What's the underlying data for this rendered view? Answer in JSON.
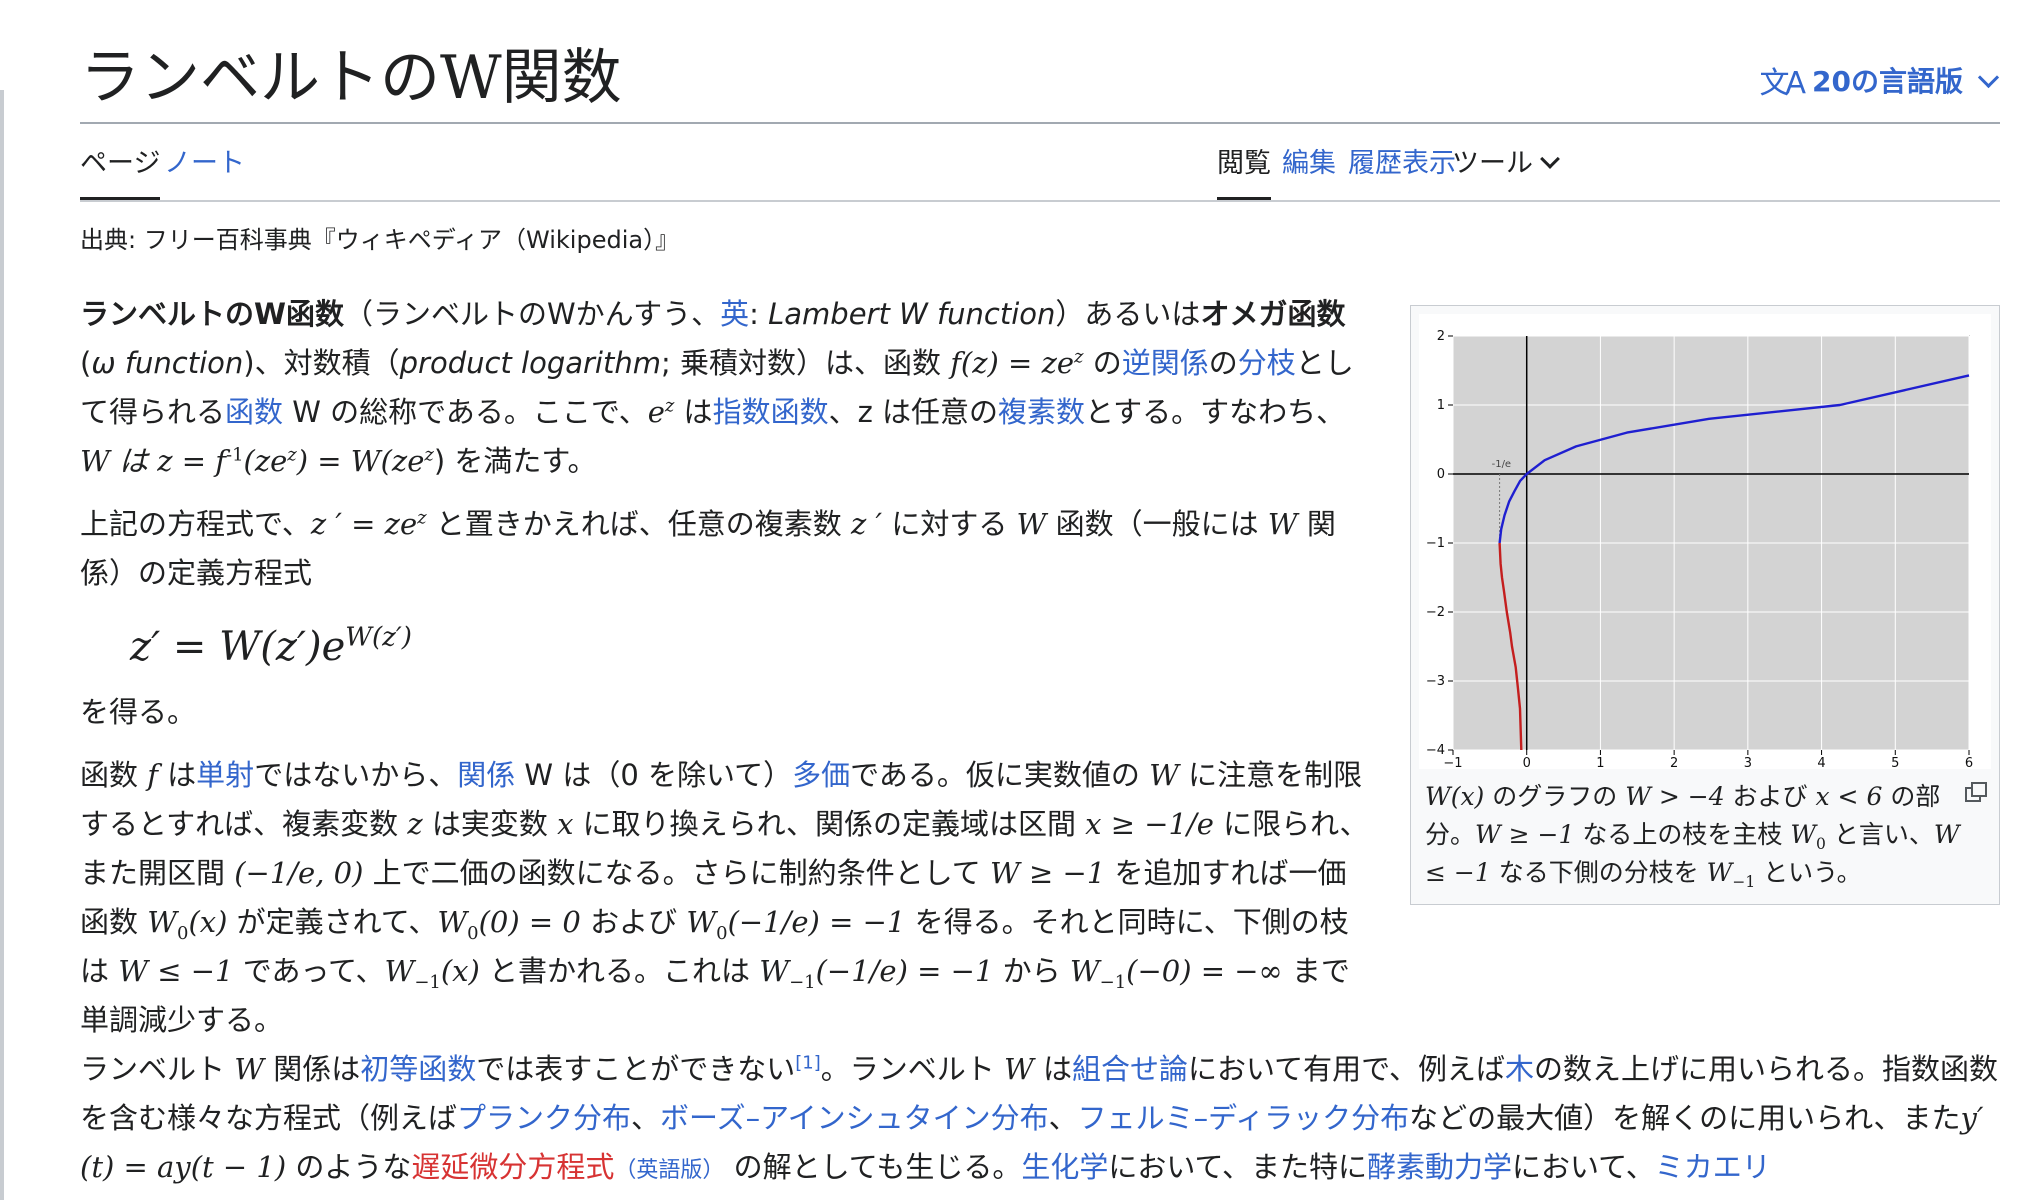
{
  "header": {
    "title": "ランベルトのW関数",
    "language_button": "20の言語版",
    "language_icon": "文A"
  },
  "tabs": {
    "page": "ページ",
    "talk": "ノート",
    "read": "閲覧",
    "edit": "編集",
    "history": "履歴表示",
    "tools": "ツール"
  },
  "site_sub": "出典: フリー百科事典『ウィキペディア（Wikipedia）』",
  "article": {
    "p1": {
      "bold_title": "ランベルトのW函数",
      "t1": "（ランベルトのWかんすう、",
      "link_en": "英",
      "t2": ": ",
      "en_name": "Lambert W function",
      "t3": "）あるいは",
      "bold_omega": "オメガ函数",
      "t4": " (",
      "omega_name": "ω function",
      "t5": ")、対数積（",
      "product_log": "product logarithm",
      "t6": "; 乗積対数）は、函数 ",
      "fz": "f(z) = ze",
      "fz_sup": "z",
      "t7": " の",
      "link_inverse": "逆関係",
      "t8": "の",
      "link_branch": "分枝",
      "t9": "として得られる",
      "link_function": "函数",
      "t10": " W の総称である。ここで、",
      "ez": "e",
      "ez_sup": "z",
      "t11": " は",
      "link_exp": "指数函数",
      "t12": "、z は任意の",
      "link_complex": "複素数",
      "t13": "とする。すなわち、",
      "formula": "W は z = f",
      "formula_sup": "-1",
      "formula2": "(ze",
      "formula2_sup": "z",
      "formula3": ") = W(ze",
      "formula3_sup": "z",
      "formula4": ") を満たす。"
    },
    "p2": {
      "t1": "上記の方程式で、",
      "m1": "z ′ = ze",
      "m1_sup": "z",
      "t2": " と置きかえれば、任意の複素数 ",
      "m2": "z ′",
      "t3": " に対する ",
      "m3": "W",
      "t4": " 函数（一般には ",
      "m4": "W",
      "t5": " 関係）の定義方程式"
    },
    "equation": {
      "lhs": "z′ = W(z′)e",
      "sup": "W(z′)"
    },
    "p3": "を得る。",
    "p4": {
      "t1": "函数 ",
      "m_f": "f",
      "t2": " は",
      "link_injective": "単射",
      "t3": "ではないから、",
      "link_relation": "関係",
      "t4": " W は（0 を除いて）",
      "link_multi": "多価",
      "t5": "である。仮に実数値の ",
      "m_w": "W",
      "t6": " に注意を制限するとすれば、複素変数 ",
      "m_z": "z",
      "t7": " は実変数 ",
      "m_x": "x",
      "t8": " に取り換えられ、関係の定義域は区間 ",
      "m_int": "x ≥ −1/e",
      "t9": " に限られ、また開区間 ",
      "m_open": "(−1/e, 0)",
      "t10": " 上で二価の函数になる。さらに制約条件として ",
      "m_cond": "W ≥ −1",
      "t11": " を追加すれば一価函数 ",
      "m_w0": "W",
      "m_w0_sub": "0",
      "m_w0_arg": "(x)",
      "t12": " が定義されて、",
      "m_w00": "W",
      "m_w00_sub": "0",
      "m_w00_rest": "(0) = 0",
      "t13": " および ",
      "m_w0e": "W",
      "m_w0e_sub": "0",
      "m_w0e_rest": "(−1/e) = −1",
      "t14": " を得る。それと同時に、下側の枝は ",
      "m_low": "W ≤ −1",
      "t15": " であって、",
      "m_wm": "W",
      "m_wm_sub": "−1",
      "m_wm_rest": "(x)",
      "t16": " と書かれる。これは ",
      "m_wme": "W",
      "m_wme_sub": "−1",
      "m_wme_rest": "(−1/e) = −1",
      "t17": " から ",
      "m_wm0": "W",
      "m_wm0_sub": "−1",
      "m_wm0_rest": "(−0) = −∞",
      "t18": " まで単調減少する。"
    },
    "p5": {
      "t1": "ランベルト ",
      "m1": "W",
      "t2": " 関係は",
      "link_elem": "初等函数",
      "t3": "では表すことができない",
      "ref": "[1]",
      "t4": "。ランベルト ",
      "m2": "W",
      "t5": " は",
      "link_comb": "組合せ論",
      "t6": "において有用で、例えば",
      "link_tree": "木",
      "t7": "の数え上げに用いられる。指数函数を含む様々な方程式（例えば",
      "link_planck": "プランク分布",
      "t8": "、",
      "link_bose": "ボーズ–アインシュタイン分布",
      "t9": "、",
      "link_fermi": "フェルミ–ディラック分布",
      "t10": "などの最大値）を解くのに用いられ、また",
      "m_dde": "y′(t) = ay(t − 1)",
      "t11": " のような",
      "link_delay": "遅延微分方程式",
      "small_en": "（英語版）",
      "t12": " の解としても生じる。",
      "link_biochem": "生化学",
      "t13": "において、また特に",
      "link_enzyme": "酵素動力学",
      "t14": "において、",
      "link_michaelis": "ミカエリ"
    }
  },
  "figure": {
    "caption": {
      "m1": "W(x)",
      "t1": " のグラフの ",
      "m2": "W > −4",
      "t2": " および ",
      "m3": "x < 6",
      "t3": " の部分。",
      "m4": "W ≥ −1",
      "t4": " なる上の枝を主枝 ",
      "m5": "W",
      "m5_sub": "0",
      "t5": " と言い、",
      "m6": "W ≤ −1",
      "t6": " なる下側の分枝を ",
      "m7": "W",
      "m7_sub": "−1",
      "t7": " という。"
    },
    "colors": {
      "plot_bg": "#d3d3d3",
      "grid": "#ffffff",
      "principal": "#1f1fd0",
      "lower": "#c41e1e"
    }
  },
  "chart_data": {
    "type": "line",
    "title": "",
    "xlabel": "",
    "ylabel": "",
    "xlim": [
      -1,
      6
    ],
    "ylim": [
      -4,
      2
    ],
    "x_ticks": [
      "−1",
      "0",
      "1",
      "2",
      "3",
      "4",
      "5",
      "6"
    ],
    "y_ticks": [
      "−4",
      "−3",
      "−2",
      "−1",
      "0",
      "1",
      "2"
    ],
    "annotation": "-1/e",
    "grid": true,
    "series": [
      {
        "name": "",
        "color": "#1f1fd0",
        "x": [
          -0.3679,
          -0.3466,
          -0.3012,
          -0.2388,
          -0.1672,
          -0.0892,
          0,
          0.2443,
          0.6694,
          1.3591,
          2.4739,
          4.2485,
          6
        ],
        "y": [
          -1,
          -0.8,
          -0.6,
          -0.4,
          -0.25,
          -0.1,
          0,
          0.2,
          0.4,
          0.6,
          0.8,
          1.0,
          1.4296
        ]
      },
      {
        "name": "",
        "color": "#c41e1e",
        "x": [
          -0.3679,
          -0.3547,
          -0.3347,
          -0.3085,
          -0.2707,
          -0.224,
          -0.1992,
          -0.1494,
          -0.1192,
          -0.0913,
          -0.0733
        ],
        "y": [
          -1,
          -1.3,
          -1.5,
          -1.7,
          -2.0,
          -2.3,
          -2.5,
          -2.8,
          -3.1,
          -3.4,
          -4.0
        ]
      }
    ]
  }
}
